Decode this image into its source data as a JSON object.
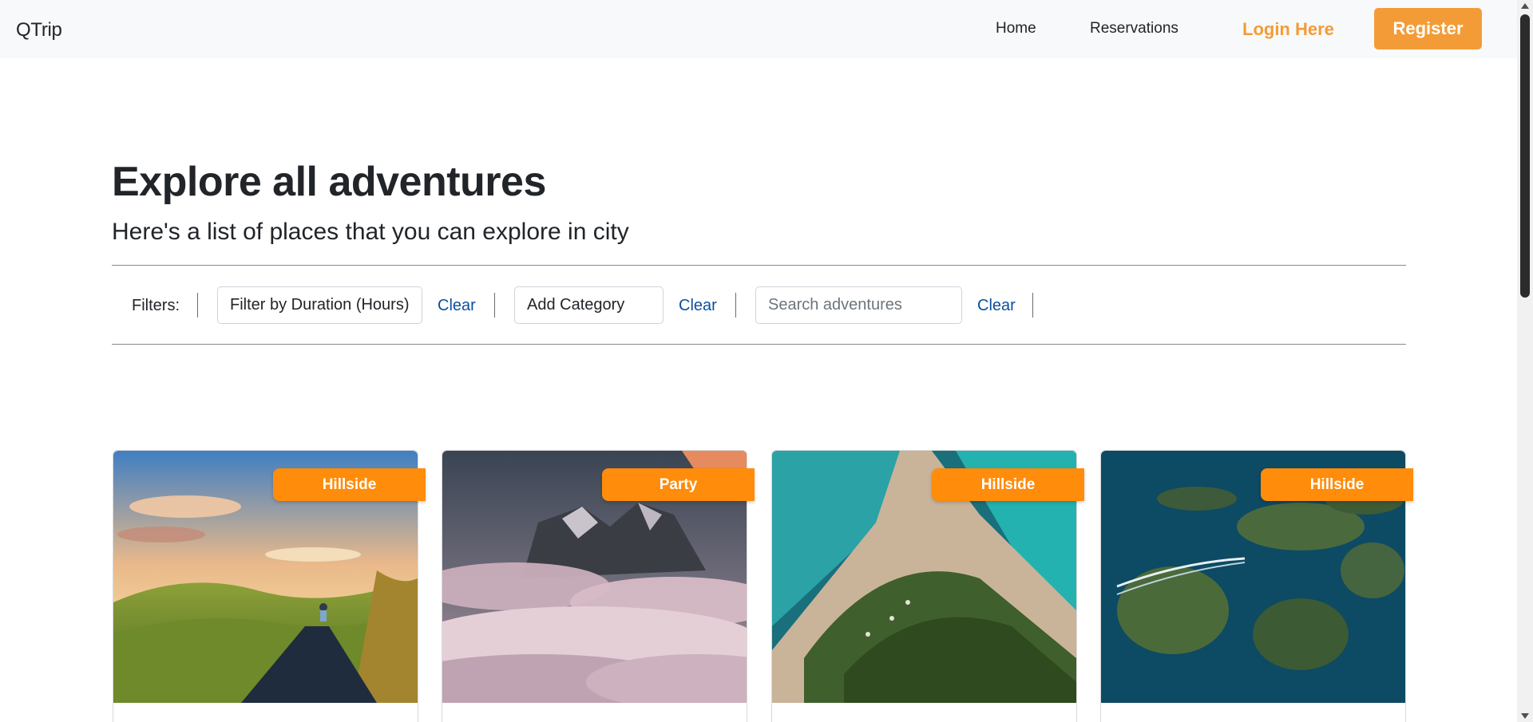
{
  "nav": {
    "brand": "QTrip",
    "home": "Home",
    "reservations": "Reservations",
    "login": "Login Here",
    "register": "Register"
  },
  "hero": {
    "title": "Explore all adventures",
    "subtitle": "Here's a list of places that you can explore in city"
  },
  "filters": {
    "label": "Filters:",
    "duration": "Filter by Duration (Hours)",
    "category": "Add Category",
    "search_placeholder": "Search adventures",
    "clear": "Clear"
  },
  "cards": [
    {
      "category": "Hillside"
    },
    {
      "category": "Party"
    },
    {
      "category": "Hillside"
    },
    {
      "category": "Hillside"
    }
  ],
  "colors": {
    "accent": "#f39c37",
    "badge": "#ff8c0a",
    "link": "#0d4fa0"
  }
}
